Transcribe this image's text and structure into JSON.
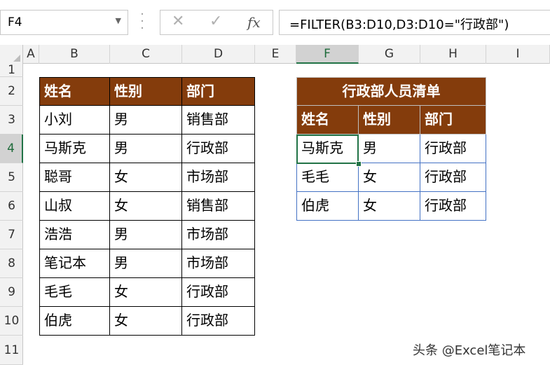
{
  "formula_bar": {
    "name_box": "F4",
    "cancel_icon": "✕",
    "enter_icon": "✓",
    "fx_label": "fx",
    "formula": "=FILTER(B3:D10,D3:D10=\"行政部\")"
  },
  "columns": [
    "A",
    "B",
    "C",
    "D",
    "E",
    "F",
    "G",
    "H",
    "I"
  ],
  "rows": [
    "1",
    "2",
    "3",
    "4",
    "5",
    "6",
    "7",
    "8",
    "9",
    "10",
    "11"
  ],
  "source_table": {
    "headers": [
      "姓名",
      "性别",
      "部门"
    ],
    "rows": [
      [
        "小刘",
        "男",
        "销售部"
      ],
      [
        "马斯克",
        "男",
        "行政部"
      ],
      [
        "聪哥",
        "女",
        "市场部"
      ],
      [
        "山叔",
        "女",
        "销售部"
      ],
      [
        "浩浩",
        "男",
        "市场部"
      ],
      [
        "笔记本",
        "男",
        "市场部"
      ],
      [
        "毛毛",
        "女",
        "行政部"
      ],
      [
        "伯虎",
        "女",
        "行政部"
      ]
    ]
  },
  "result_table": {
    "title": "行政部人员清单",
    "headers": [
      "姓名",
      "性别",
      "部门"
    ],
    "rows": [
      [
        "马斯克",
        "男",
        "行政部"
      ],
      [
        "毛毛",
        "女",
        "行政部"
      ],
      [
        "伯虎",
        "女",
        "行政部"
      ]
    ]
  },
  "selection": {
    "active_column": "F",
    "active_row": "4"
  },
  "colors": {
    "header_fill": "#843c0c",
    "header_text": "#ffffff",
    "selection": "#217346",
    "result_border": "#4472c4"
  },
  "watermark": "头条 @Excel笔记本"
}
